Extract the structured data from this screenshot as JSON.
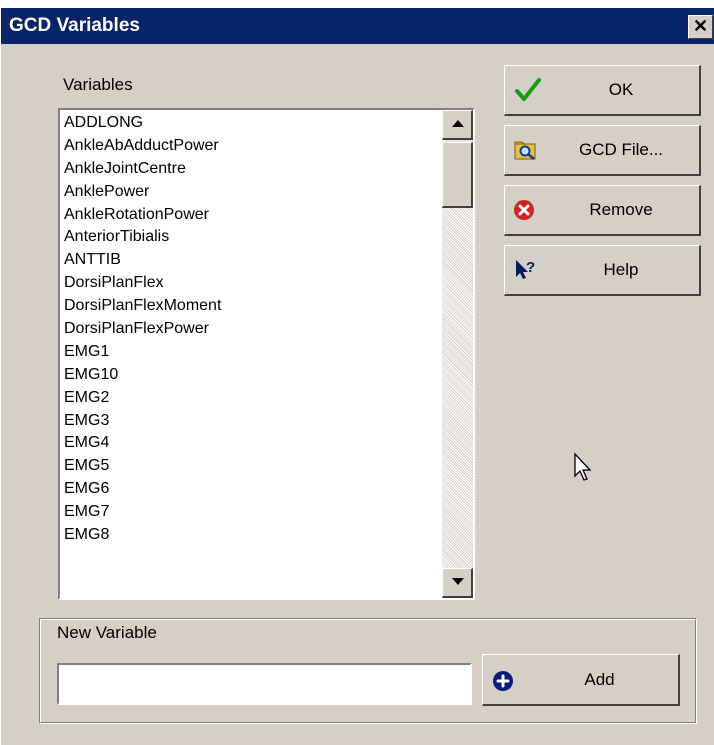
{
  "window": {
    "title": "GCD Variables",
    "close_glyph": "✕"
  },
  "variables": {
    "label": "Variables",
    "items": [
      "ADDLONG",
      "AnkleAbAdductPower",
      "AnkleJointCentre",
      "AnklePower",
      "AnkleRotationPower",
      "AnteriorTibialis",
      "ANTTIB",
      "DorsiPlanFlex",
      "DorsiPlanFlexMoment",
      "DorsiPlanFlexPower",
      "EMG1",
      "EMG10",
      "EMG2",
      "EMG3",
      "EMG4",
      "EMG5",
      "EMG6",
      "EMG7",
      "EMG8"
    ]
  },
  "buttons": {
    "ok": {
      "label": "OK",
      "icon": "checkmark-icon"
    },
    "gcd_file": {
      "label": "GCD File...",
      "icon": "folder-search-icon"
    },
    "remove": {
      "label": "Remove",
      "icon": "remove-icon"
    },
    "help": {
      "label": "Help",
      "icon": "help-pointer-icon"
    },
    "add": {
      "label": "Add",
      "icon": "add-icon"
    }
  },
  "new_variable": {
    "label": "New Variable",
    "value": "",
    "placeholder": ""
  },
  "colors": {
    "titlebar": "#0a246a",
    "face": "#d4d0c8",
    "ok_check": "#1a9a1a",
    "remove_red": "#d42020",
    "add_blue": "#0b1d7a"
  }
}
